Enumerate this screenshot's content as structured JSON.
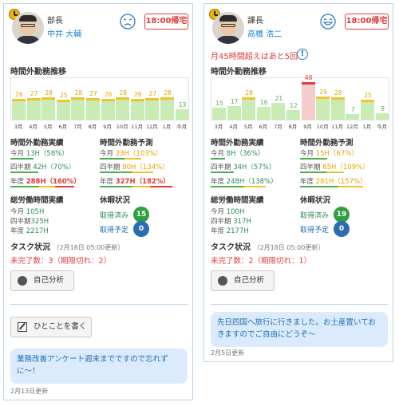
{
  "months": [
    "3月",
    "4月",
    "5月",
    "6月",
    "7月",
    "8月",
    "9月",
    "10月",
    "11月",
    "12月",
    "1月",
    "今月"
  ],
  "labels": {
    "chart_title": "時間外勤務推移",
    "actual_title": "時間外勤務実績",
    "forecast_title": "時間外勤務予測",
    "total_title": "総労働時間実績",
    "leave_title": "休暇状況",
    "task_title": "タスク状況",
    "self_analysis": "自己分析",
    "write_comment": "ひとことを書く",
    "this_month": "今月",
    "quarter": "四半期",
    "year": "年度",
    "taken": "取得済み",
    "planned": "取得予定"
  },
  "cards": [
    {
      "role": "部長",
      "name": "中井 大輔",
      "mood": "sad",
      "badge": "18:00帰宅",
      "alert": "",
      "chart": {
        "values": [
          26,
          27,
          28,
          25,
          28,
          27,
          26,
          28,
          26,
          27,
          28,
          13
        ],
        "levels": [
          "y",
          "y",
          "y",
          "y",
          "y",
          "y",
          "y",
          "y",
          "y",
          "y",
          "y",
          "g"
        ]
      },
      "actual": [
        {
          "label": "今月",
          "value": "13H",
          "pct": "（58%）"
        },
        {
          "label": "四半期",
          "value": "42H",
          "pct": "（70%）"
        },
        {
          "label": "年度",
          "value": "288H",
          "pct": "（160%）",
          "alert": true
        }
      ],
      "forecast": [
        {
          "label": "今月",
          "value": "23H",
          "pct": "（103%）"
        },
        {
          "label": "四半期",
          "value": "80H",
          "pct": "（134%）"
        },
        {
          "label": "年度",
          "value": "327H",
          "pct": "（182%）",
          "alert": true
        }
      ],
      "total": [
        {
          "label": "今月",
          "value": "105H"
        },
        {
          "label": "四半期",
          "value": "325H"
        },
        {
          "label": "年度",
          "value": "2217H"
        }
      ],
      "leave_taken": "15",
      "leave_planned": "0",
      "task_date": "（2月18日 05:00更新）",
      "task_detail": "未完了数：3（期限切れ：2）",
      "comment": "業務改善アンケート週末までですので忘れずに〜！",
      "comment_date": "2月13日更新"
    },
    {
      "role": "課長",
      "name": "高橋 浩二",
      "mood": "happy",
      "badge": "18:00帰宅",
      "alert": "月45時間超えはあと5回",
      "chart": {
        "values": [
          15,
          17,
          28,
          16,
          21,
          12,
          48,
          29,
          28,
          7,
          25,
          8
        ],
        "levels": [
          "g",
          "g",
          "y",
          "g",
          "g",
          "g",
          "r",
          "y",
          "y",
          "g",
          "y",
          "g"
        ]
      },
      "actual": [
        {
          "label": "今月",
          "value": "8H",
          "pct": "（36%）"
        },
        {
          "label": "四半期",
          "value": "34H",
          "pct": "（57%）"
        },
        {
          "label": "年度",
          "value": "248H",
          "pct": "（138%）"
        }
      ],
      "forecast": [
        {
          "label": "今月",
          "value": "15H",
          "pct": "（67%）"
        },
        {
          "label": "四半期",
          "value": "65H",
          "pct": "（109%）"
        },
        {
          "label": "年度",
          "value": "281H",
          "pct": "（157%）"
        }
      ],
      "total": [
        {
          "label": "今月",
          "value": "100H"
        },
        {
          "label": "四半期",
          "value": "317H"
        },
        {
          "label": "年度",
          "value": "2177H"
        }
      ],
      "leave_taken": "19",
      "leave_planned": "0",
      "task_date": "（2月18日 05:00更新）",
      "task_detail": "未完了数：2（期限切れ：1）",
      "comment": "先日四国へ旅行に行きました。お土産置いておきますのでご自由にどうぞ〜",
      "comment_date": "2月5日更新"
    }
  ]
}
